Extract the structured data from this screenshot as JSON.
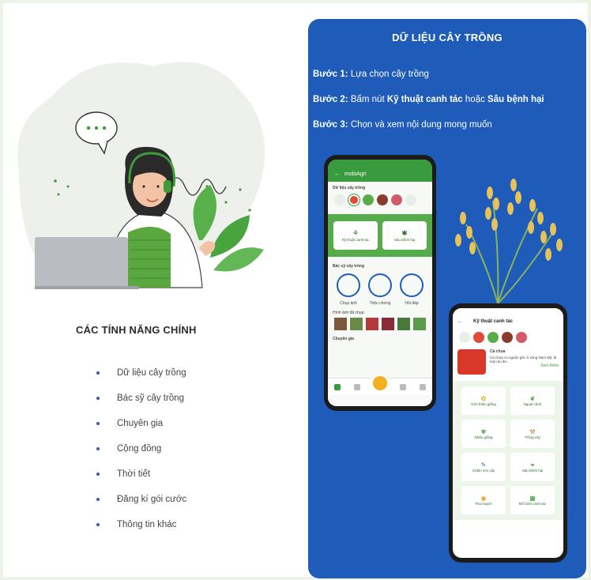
{
  "features": {
    "title": "CÁC TÍNH NĂNG CHÍNH",
    "items": [
      "Dữ liệu cây trồng",
      "Bác sỹ cây trồng",
      "Chuyên gia",
      "Cộng đồng",
      "Thời tiết",
      "Đăng kí gói cước",
      "Thông tin khác"
    ]
  },
  "panel": {
    "title": "DỮ LIỆU CÂY TRỒNG",
    "step1_label": "Bước 1:",
    "step1_text": " Lựa chọn cây trồng",
    "step2_label": "Bước 2:",
    "step2_text_a": " Bấm nút ",
    "step2_bold_a": "Kỹ thuật canh tác",
    "step2_text_b": " hoặc ",
    "step2_bold_b": "Sâu bệnh hại",
    "step3_label": "Bước 3:",
    "step3_text": " Chọn và xem nội dung mong muốn"
  },
  "phone1": {
    "app_name": "mobiAgri",
    "section1": "Dữ liệu cây trồng",
    "btn1": "Kỹ thuật canh tác",
    "btn2": "Sâu bệnh hại",
    "section2": "Bác sỹ cây trồng",
    "doc_items": [
      "Chụp ảnh",
      "Triệu chứng",
      "Hỏi đáp"
    ],
    "section3": "Hình ảnh đã chụp",
    "section4": "Chuyên gia"
  },
  "phone2": {
    "title": "Kỹ thuật canh tác",
    "crop_name": "Cà chua",
    "crop_desc": "Cà chua có nguồn gốc ở vùng Nam Mỹ, là loại rau ăn...",
    "more": "Xem thêm",
    "tiles": [
      "Giới thiệu giống",
      "Ngoại cảnh",
      "Nhân giống",
      "Trồng cây",
      "Chăm sóc cây",
      "Sâu bệnh hại",
      "Thu hoạch",
      "Mô hình canh tác"
    ]
  },
  "colors": {
    "panel_blue": "#1f5bb8",
    "app_green": "#3a9a3e"
  }
}
